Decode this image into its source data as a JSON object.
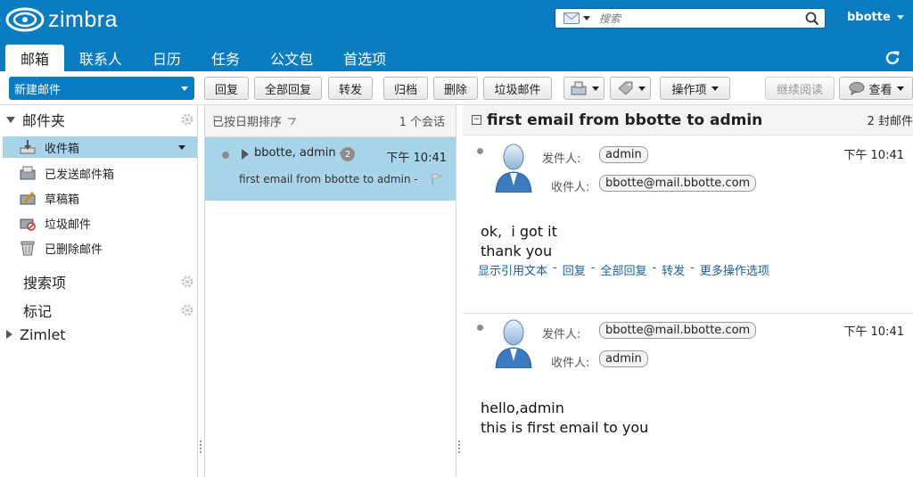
{
  "app": {
    "logo_text": "zimbra",
    "search_placeholder": "搜索",
    "username": "bbotte",
    "colors": {
      "brand": "#0a7cc1",
      "selection": "#a8d4ea"
    }
  },
  "tabs": [
    {
      "label": "邮箱",
      "active": true
    },
    {
      "label": "联系人"
    },
    {
      "label": "日历"
    },
    {
      "label": "任务"
    },
    {
      "label": "公文包"
    },
    {
      "label": "首选项"
    }
  ],
  "toolbar": {
    "new_mail": "新建邮件",
    "reply": "回复",
    "reply_all": "全部回复",
    "forward": "转发",
    "archive": "归档",
    "delete": "删除",
    "spam": "垃圾邮件",
    "actions": "操作项",
    "continue_reading": "继续阅读",
    "view": "查看"
  },
  "sidebar": {
    "mail_folders_title": "邮件夹",
    "folders": [
      {
        "label": "收件箱",
        "icon": "inbox-icon",
        "selected": true
      },
      {
        "label": "已发送邮件箱",
        "icon": "sent-icon"
      },
      {
        "label": "草稿箱",
        "icon": "drafts-icon"
      },
      {
        "label": "垃圾邮件",
        "icon": "junk-icon"
      },
      {
        "label": "已删除邮件",
        "icon": "trash-icon"
      }
    ],
    "searches_title": "搜索项",
    "tags_title": "标记",
    "zimlet_title": "Zimlet"
  },
  "list": {
    "sort_label": "已按日期排序",
    "count": "1 个会话",
    "conversation": {
      "from": "bbotte, admin -",
      "message_count": "2",
      "time": "下午 10:41",
      "subject": "first email from bbotte to admin -"
    }
  },
  "reading": {
    "subject": "first email from bbotte to admin",
    "count": "2 封邮件",
    "from_label": "发件人:",
    "to_label": "收件人:",
    "messages": [
      {
        "from": "admin",
        "to": "bbotte@mail.bbotte.com",
        "time": "下午 10:41",
        "body_line1": "ok,  i got it",
        "body_line2": "thank you"
      },
      {
        "from": "bbotte@mail.bbotte.com",
        "to": "admin",
        "time": "下午 10:41",
        "body_line1": "hello,admin",
        "body_line2": "this is first email to you"
      }
    ],
    "actions": {
      "show_quoted": "显示引用文本",
      "reply": "回复",
      "reply_all": "全部回复",
      "forward": "转发",
      "more": "更多操作选项",
      "sep": "-"
    }
  }
}
